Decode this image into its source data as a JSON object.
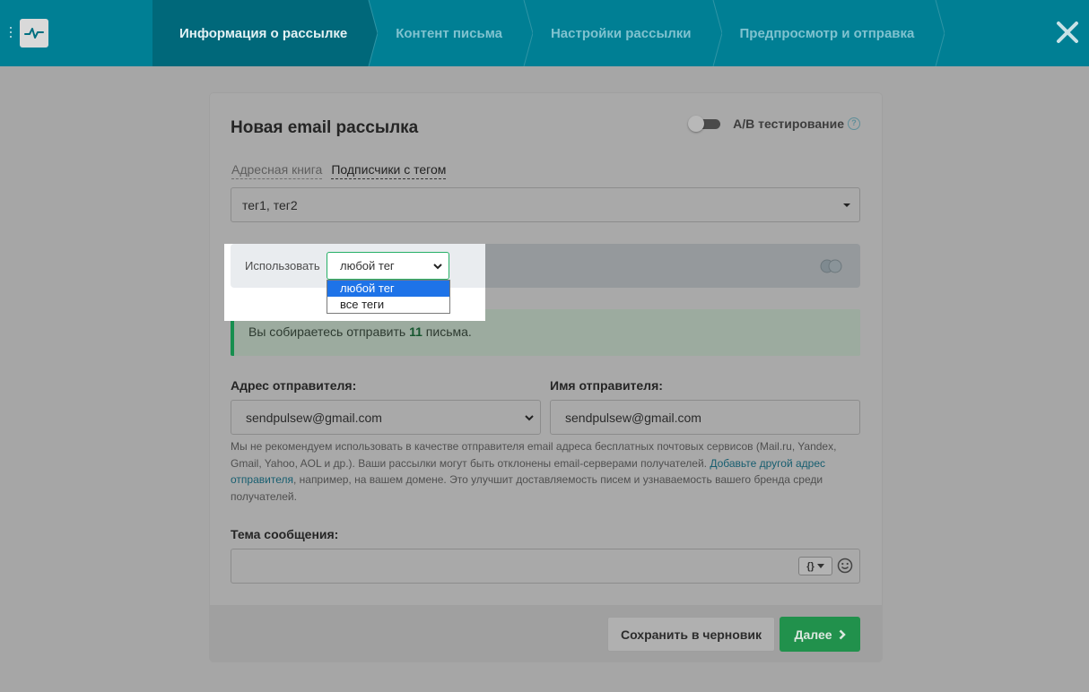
{
  "header": {
    "steps": [
      {
        "label": "Информация о рассылке",
        "active": true
      },
      {
        "label": "Контент письма",
        "active": false
      },
      {
        "label": "Настройки рассылки",
        "active": false
      },
      {
        "label": "Предпросмотр и отправка",
        "active": false
      }
    ],
    "logo_icon": "pulse-icon",
    "close_icon": "close-icon"
  },
  "form": {
    "title": "Новая email рассылка",
    "ab_testing_label": "A/B тестирование",
    "ab_testing_enabled": false,
    "help_glyph": "?",
    "tabs": [
      "Адресная книга",
      "Подписчики с тегом"
    ],
    "active_tab": "Подписчики с тегом",
    "tags_value": "тег1, тег2",
    "use_label": "Использовать",
    "use_selected": "любой тег",
    "use_options": [
      "любой тег",
      "все теги"
    ],
    "notice": {
      "prefix": "Вы собираетесь отправить ",
      "count": "11",
      "suffix": " письма."
    },
    "sender_address_label": "Адрес отправителя:",
    "sender_address_value": "sendpulsew@gmail.com",
    "sender_name_label": "Имя отправителя:",
    "sender_name_value": "sendpulsew@gmail.com",
    "hint": {
      "text1": "Мы не рекомендуем использовать в качестве отправителя email адреса бесплатных почтовых сервисов (Mail.ru, Yandex, Gmail, Yahoo, AOL и др.). Ваши рассылки могут быть отклонены email-серверами получателей. ",
      "link": "Добавьте другой адрес отправителя",
      "text2": ", например, на вашем домене. Это улучшит доставляемость писем и узнаваемость вашего бренда среди получателей."
    },
    "subject_label": "Тема сообщения:",
    "subject_value": "",
    "variables_glyph": "{}"
  },
  "footer": {
    "save_draft_label": "Сохранить в черновик",
    "next_label": "Далее"
  },
  "colors": {
    "header_bg": "#007f94",
    "header_active": "#00687a",
    "accent_green": "#21914c",
    "select_highlight": "#1e73e8"
  }
}
